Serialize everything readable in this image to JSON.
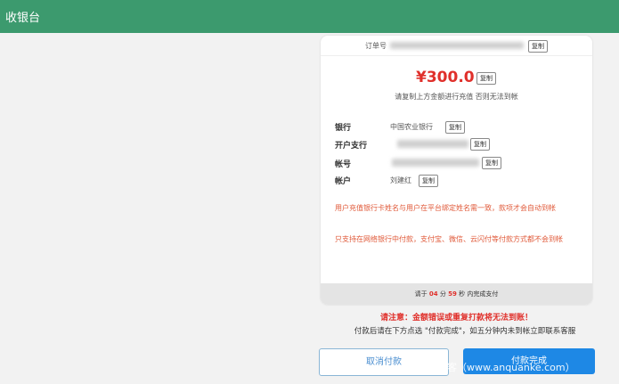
{
  "header": {
    "title": "收银台"
  },
  "order": {
    "label": "订单号",
    "copy_label": "复制"
  },
  "amount": {
    "value": "¥300.0",
    "copy_label": "复制",
    "note": "请复制上方金额进行充值 否则无法到帐"
  },
  "bank_info": {
    "bank": {
      "label": "银行",
      "value": "中国农业银行",
      "copy_label": "复制"
    },
    "branch": {
      "label": "开户支行",
      "copy_label": "复制"
    },
    "account": {
      "label": "帐号",
      "copy_label": "复制"
    },
    "holder": {
      "label": "帐户",
      "value": "刘建红",
      "copy_label": "复制"
    }
  },
  "warnings": [
    "用户充值银行卡姓名与用户在平台绑定姓名需一致，款项才会自动到帐",
    "只支持在网络银行中付款，支付宝、微信、云闪付等付款方式都不会到帐"
  ],
  "countdown": {
    "prefix": "请于",
    "minutes": "04",
    "min_unit": "分",
    "seconds": "59",
    "sec_unit": "秒",
    "suffix": "内完成支付"
  },
  "alert": "请注意：金额错误或重复打款将无法到账！",
  "hint": "付款后请在下方点选 \"付款完成\"，如五分钟内未到帐立即联系客服",
  "buttons": {
    "cancel": "取消付款",
    "done": "付款完成"
  },
  "watermark": "安全客（www.anquanke.com）",
  "colors": {
    "header": "#3c9a6e",
    "accent_red": "#e0302b",
    "primary_blue": "#1e88e5"
  }
}
